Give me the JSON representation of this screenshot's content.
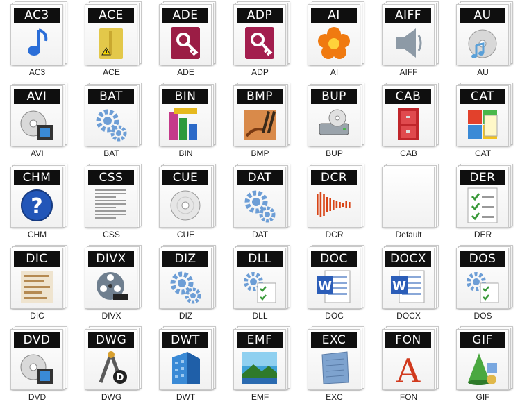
{
  "icons": [
    {
      "ext": "AC3",
      "caption": "AC3",
      "icon": "music-note-icon",
      "color": "#2b6ed8"
    },
    {
      "ext": "ACE",
      "caption": "ACE",
      "icon": "archive-folder-icon",
      "color": "#e3c84a"
    },
    {
      "ext": "ADE",
      "caption": "ADE",
      "icon": "access-key-icon",
      "color": "#9b1d45"
    },
    {
      "ext": "ADP",
      "caption": "ADP",
      "icon": "access-key-icon",
      "color": "#a31e4e"
    },
    {
      "ext": "AI",
      "caption": "AI",
      "icon": "illustrator-flower-icon",
      "color": "#f07a10"
    },
    {
      "ext": "AIFF",
      "caption": "AIFF",
      "icon": "speaker-icon",
      "color": "#8d9aa6"
    },
    {
      "ext": "AU",
      "caption": "AU",
      "icon": "audio-disc-icon",
      "color": "#5aa0d8"
    },
    {
      "ext": "AVI",
      "caption": "AVI",
      "icon": "video-disc-icon",
      "color": "#555555"
    },
    {
      "ext": "BAT",
      "caption": "BAT",
      "icon": "gears-icon",
      "color": "#6d9ed6"
    },
    {
      "ext": "BIN",
      "caption": "BIN",
      "icon": "binary-blocks-icon",
      "color": "#c43a8a"
    },
    {
      "ext": "BMP",
      "caption": "BMP",
      "icon": "paint-brushes-icon",
      "color": "#b5562a"
    },
    {
      "ext": "BUP",
      "caption": "BUP",
      "icon": "backup-drive-icon",
      "color": "#9aa3ab"
    },
    {
      "ext": "CAB",
      "caption": "CAB",
      "icon": "cabinet-icon",
      "color": "#c0262b"
    },
    {
      "ext": "CAT",
      "caption": "CAT",
      "icon": "catalog-notepad-icon",
      "color": "#3a8ad6"
    },
    {
      "ext": "CHM",
      "caption": "CHM",
      "icon": "help-question-icon",
      "color": "#2256b8"
    },
    {
      "ext": "CSS",
      "caption": "CSS",
      "icon": "text-lines-icon",
      "color": "#9a9a9a"
    },
    {
      "ext": "CUE",
      "caption": "CUE",
      "icon": "disc-icon",
      "color": "#b8b8b8"
    },
    {
      "ext": "DAT",
      "caption": "DAT",
      "icon": "gears-icon",
      "color": "#6d9ed6"
    },
    {
      "ext": "DCR",
      "caption": "DCR",
      "icon": "director-bars-icon",
      "color": "#d84416"
    },
    {
      "ext": "",
      "caption": "Default",
      "icon": "blank-document-icon",
      "color": "#e6e6e6"
    },
    {
      "ext": "DER",
      "caption": "DER",
      "icon": "checklist-icon",
      "color": "#3a9a3a"
    },
    {
      "ext": "DIC",
      "caption": "DIC",
      "icon": "dictionary-page-icon",
      "color": "#b58a52"
    },
    {
      "ext": "DIVX",
      "caption": "DIVX",
      "icon": "film-reel-icon",
      "color": "#6f7f8f"
    },
    {
      "ext": "DIZ",
      "caption": "DIZ",
      "icon": "gears-icon",
      "color": "#6d9ed6"
    },
    {
      "ext": "DLL",
      "caption": "DLL",
      "icon": "gear-checklist-icon",
      "color": "#6d9ed6"
    },
    {
      "ext": "DOC",
      "caption": "DOC",
      "icon": "word-document-icon",
      "color": "#2b5db8"
    },
    {
      "ext": "DOCX",
      "caption": "DOCX",
      "icon": "word-document-icon",
      "color": "#2b5db8"
    },
    {
      "ext": "DOS",
      "caption": "DOS",
      "icon": "gear-checklist-icon",
      "color": "#6d9ed6"
    },
    {
      "ext": "DVD",
      "caption": "DVD",
      "icon": "video-disc-icon",
      "color": "#7a7a7a"
    },
    {
      "ext": "DWG",
      "caption": "DWG",
      "icon": "drafting-compass-icon",
      "color": "#5a5a5a"
    },
    {
      "ext": "DWT",
      "caption": "DWT",
      "icon": "blue-building-icon",
      "color": "#3a8ad6"
    },
    {
      "ext": "EMF",
      "caption": "EMF",
      "icon": "landscape-photo-icon",
      "color": "#3fa3d8"
    },
    {
      "ext": "EXC",
      "caption": "EXC",
      "icon": "notepad-icon",
      "color": "#7ea3cf"
    },
    {
      "ext": "FON",
      "caption": "FON",
      "icon": "font-a-icon",
      "color": "#d13a1e"
    },
    {
      "ext": "GIF",
      "caption": "GIF",
      "icon": "shapes-cone-icon",
      "color": "#4aa840"
    }
  ]
}
